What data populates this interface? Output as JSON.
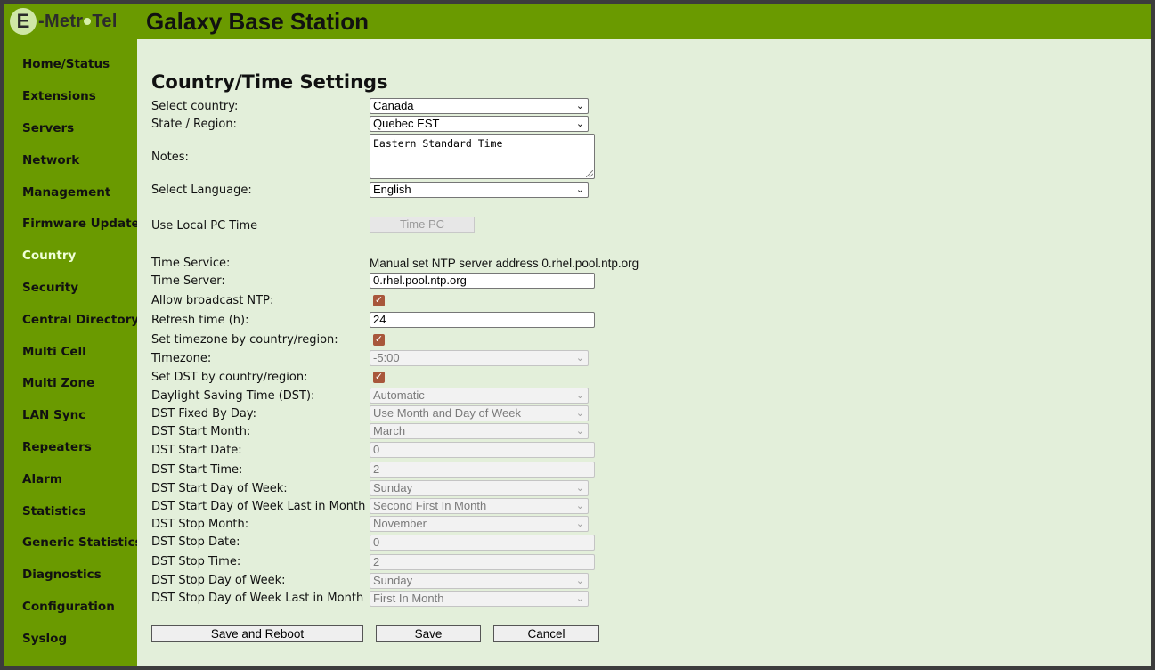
{
  "header": {
    "logo_letter": "E",
    "logo_text_a": "-Metr",
    "logo_text_b": "Tel",
    "title": "Galaxy Base Station"
  },
  "sidebar": {
    "items": [
      {
        "label": "Home/Status"
      },
      {
        "label": "Extensions"
      },
      {
        "label": "Servers"
      },
      {
        "label": "Network"
      },
      {
        "label": "Management"
      },
      {
        "label": "Firmware Update"
      },
      {
        "label": "Country",
        "active": true
      },
      {
        "label": "Security"
      },
      {
        "label": "Central Directory"
      },
      {
        "label": "Multi Cell"
      },
      {
        "label": "Multi Zone"
      },
      {
        "label": "LAN Sync"
      },
      {
        "label": "Repeaters"
      },
      {
        "label": "Alarm"
      },
      {
        "label": "Statistics"
      },
      {
        "label": "Generic Statistics"
      },
      {
        "label": "Diagnostics"
      },
      {
        "label": "Configuration"
      },
      {
        "label": "Syslog"
      }
    ]
  },
  "page": {
    "title": "Country/Time Settings"
  },
  "form": {
    "country": {
      "label": "Select country:",
      "value": "Canada"
    },
    "region": {
      "label": "State / Region:",
      "value": "Quebec EST"
    },
    "notes": {
      "label": "Notes:",
      "value": "Eastern Standard Time"
    },
    "language": {
      "label": "Select Language:",
      "value": "English"
    },
    "local_pc_time": {
      "label": "Use Local PC Time",
      "button": "Time PC"
    },
    "time_service": {
      "label": "Time Service:",
      "value": "Manual set NTP server address 0.rhel.pool.ntp.org"
    },
    "time_server": {
      "label": "Time Server:",
      "value": "0.rhel.pool.ntp.org"
    },
    "allow_broadcast": {
      "label": "Allow broadcast NTP:",
      "checked": true
    },
    "refresh": {
      "label": "Refresh time (h):",
      "value": "24"
    },
    "tz_by_country": {
      "label": "Set timezone by country/region:",
      "checked": true
    },
    "timezone": {
      "label": "Timezone:",
      "value": "-5:00"
    },
    "dst_by_country": {
      "label": "Set DST by country/region:",
      "checked": true
    },
    "dst": {
      "label": "Daylight Saving Time (DST):",
      "value": "Automatic"
    },
    "dst_fixed_by_day": {
      "label": "DST Fixed By Day:",
      "value": "Use Month and Day of Week"
    },
    "dst_start_month": {
      "label": "DST Start Month:",
      "value": "March"
    },
    "dst_start_date": {
      "label": "DST Start Date:",
      "value": "0"
    },
    "dst_start_time": {
      "label": "DST Start Time:",
      "value": "2"
    },
    "dst_start_dow": {
      "label": "DST Start Day of Week:",
      "value": "Sunday"
    },
    "dst_start_dow_last": {
      "label": "DST Start Day of Week Last in Month",
      "value": "Second First In Month"
    },
    "dst_stop_month": {
      "label": "DST Stop Month:",
      "value": "November"
    },
    "dst_stop_date": {
      "label": "DST Stop Date:",
      "value": "0"
    },
    "dst_stop_time": {
      "label": "DST Stop Time:",
      "value": "2"
    },
    "dst_stop_dow": {
      "label": "DST Stop Day of Week:",
      "value": "Sunday"
    },
    "dst_stop_dow_last": {
      "label": "DST Stop Day of Week Last in Month",
      "value": "First In Month"
    }
  },
  "actions": {
    "save_reboot": "Save and Reboot",
    "save": "Save",
    "cancel": "Cancel"
  },
  "icons": {
    "dropdown_arrow": "chevron-down-icon",
    "checkbox_check": "checkmark-icon"
  },
  "colors": {
    "brand_green": "#6a9a00",
    "content_bg": "#e3efda",
    "active_nav": "#f0ffd8",
    "checkbox": "#a8573b"
  }
}
